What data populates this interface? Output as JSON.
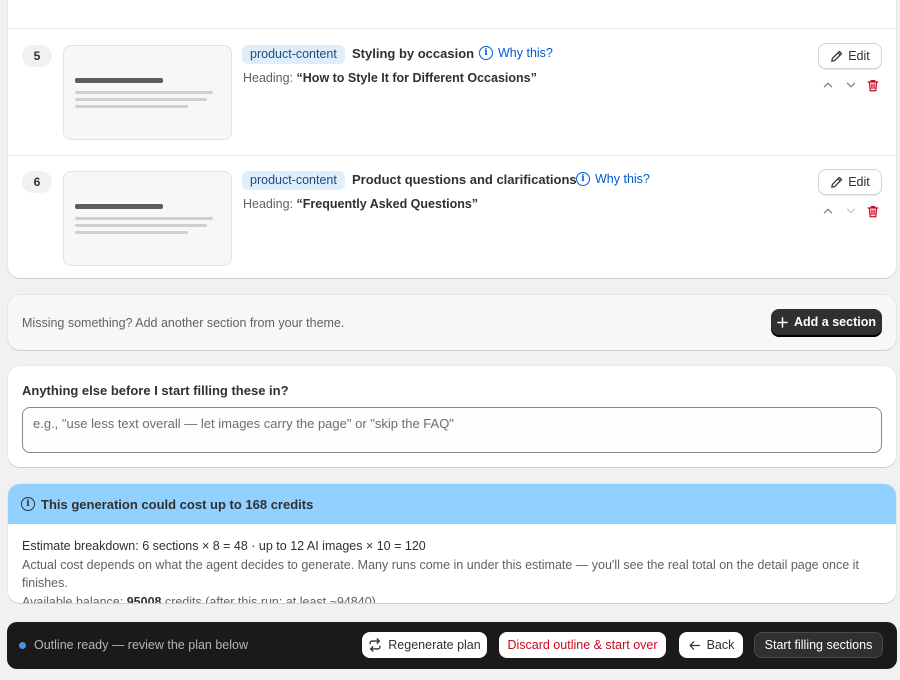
{
  "sections": [
    {
      "number": "5",
      "tag": "product-content",
      "title": "Styling by occasion",
      "why_label": "Why this?",
      "heading_label": "Heading:",
      "heading_value": "“How to Style It for Different Occasions”",
      "edit_label": "Edit"
    },
    {
      "number": "6",
      "tag": "product-content",
      "title": "Product questions and clarifications",
      "why_label": "Why this?",
      "heading_label": "Heading:",
      "heading_value": "“Frequently Asked Questions”",
      "edit_label": "Edit"
    }
  ],
  "add_section": {
    "message": "Missing something? Add another section from your theme.",
    "button_label": "Add a section"
  },
  "note": {
    "question": "Anything else before I start filling these in?",
    "placeholder": "e.g., \"use less text overall — let images carry the page\" or \"skip the FAQ\"",
    "value": ""
  },
  "cost": {
    "title": "This generation could cost up to 168 credits",
    "breakdown": "Estimate breakdown: 6 sections × 8 = 48 · up to 12 AI images × 10 = 120",
    "explanation": "Actual cost depends on what the agent decides to generate. Many runs come in under this estimate — you'll see the real total on the detail page once it finishes.",
    "balance_prefix": "Available balance: ",
    "balance_value": "95008",
    "balance_suffix": " credits (after this run: at least ~94840)"
  },
  "bottom_bar": {
    "status": "Outline ready — review the plan below",
    "regenerate_label": "Regenerate plan",
    "discard_label": "Discard outline & start over",
    "back_label": "Back",
    "start_label": "Start filling sections"
  },
  "colors": {
    "accent": "#005bd3",
    "tag_bg": "#e0eefb",
    "cost_banner": "#91d0ff",
    "danger": "#c70a24",
    "dark_button": "#303030"
  },
  "icons": [
    "info-icon",
    "pencil-icon",
    "chevron-up-icon",
    "chevron-down-icon",
    "trash-icon",
    "plus-icon",
    "refresh-icon",
    "arrow-left-icon"
  ]
}
